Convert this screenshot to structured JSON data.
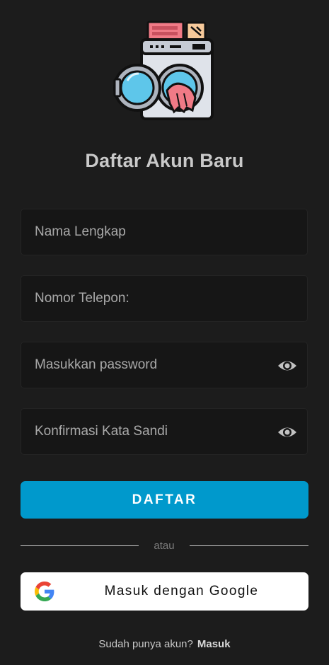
{
  "logo": {
    "icon": "washing-machine-icon",
    "colors": {
      "body": "#dfe3ea",
      "outline": "#111111",
      "glass": "#5ec6ea",
      "cloth": "#f07a86",
      "detergent": "#f07a86",
      "box": "#f6c99a"
    }
  },
  "title": "Daftar Akun Baru",
  "form": {
    "name_placeholder": "Nama Lengkap",
    "phone_placeholder": "Nomor Telepon:",
    "password_placeholder": "Masukkan password",
    "confirm_placeholder": "Konfirmasi Kata Sandi",
    "eye_icon": "eye-icon"
  },
  "register_button": "DAFTAR",
  "divider_text": "atau",
  "google_button": {
    "label": "Masuk dengan Google",
    "icon": "google-logo-icon"
  },
  "footer": {
    "prompt": "Sudah punya akun?",
    "link": "Masuk"
  },
  "colors": {
    "background": "#1c1c1c",
    "field_background": "#161616",
    "accent": "#0099cc",
    "google_button_background": "#ffffff"
  }
}
